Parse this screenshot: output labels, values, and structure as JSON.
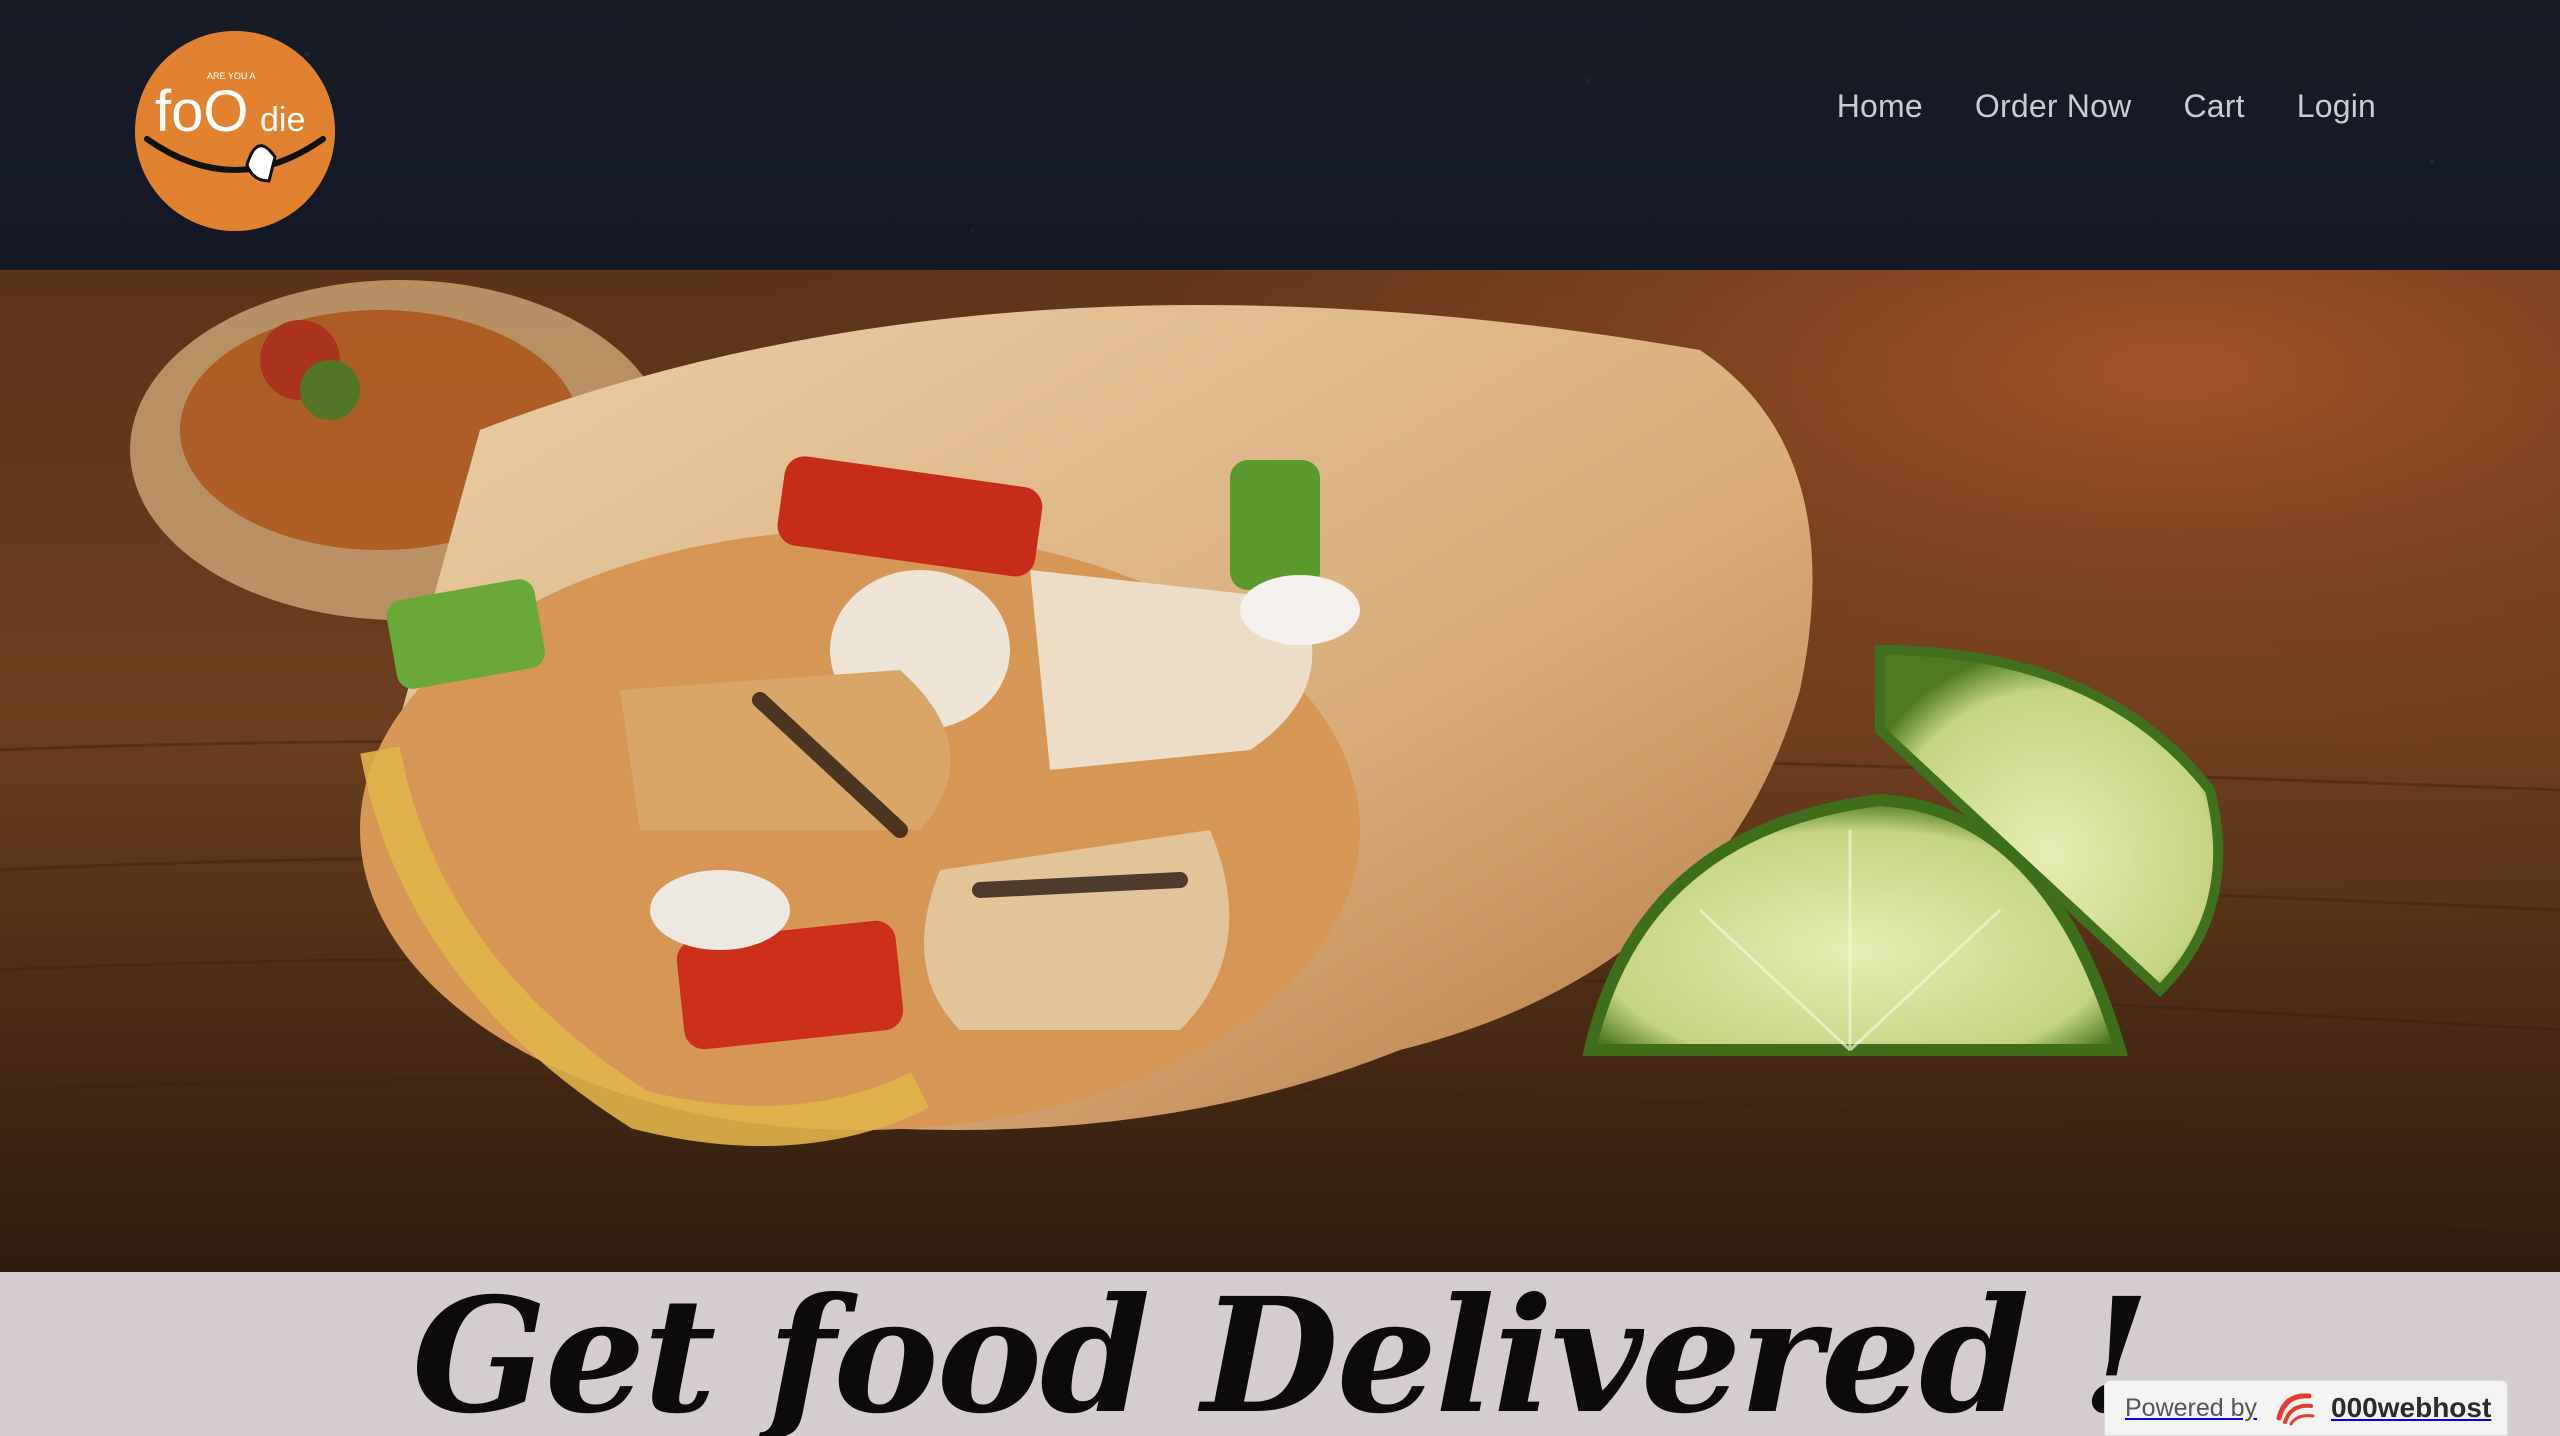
{
  "logo": {
    "top_text": "ARE YOU A",
    "wordmark_foo": "foO",
    "wordmark_die": "die",
    "color": "#e0822f"
  },
  "nav": {
    "items": [
      {
        "label": "Home"
      },
      {
        "label": "Order Now"
      },
      {
        "label": "Cart"
      },
      {
        "label": "Login"
      }
    ]
  },
  "hero": {
    "image": "burrito-with-lime-wedges"
  },
  "tagline": "Get food Delivered !",
  "badge": {
    "powered_label": "Powered by",
    "host_label": "000webhost",
    "icon": "000webhost-logo-icon"
  },
  "colors": {
    "header_bg": "#161b26",
    "nav_text": "#c9ccd3",
    "band_bg": "#d5cdcd"
  }
}
